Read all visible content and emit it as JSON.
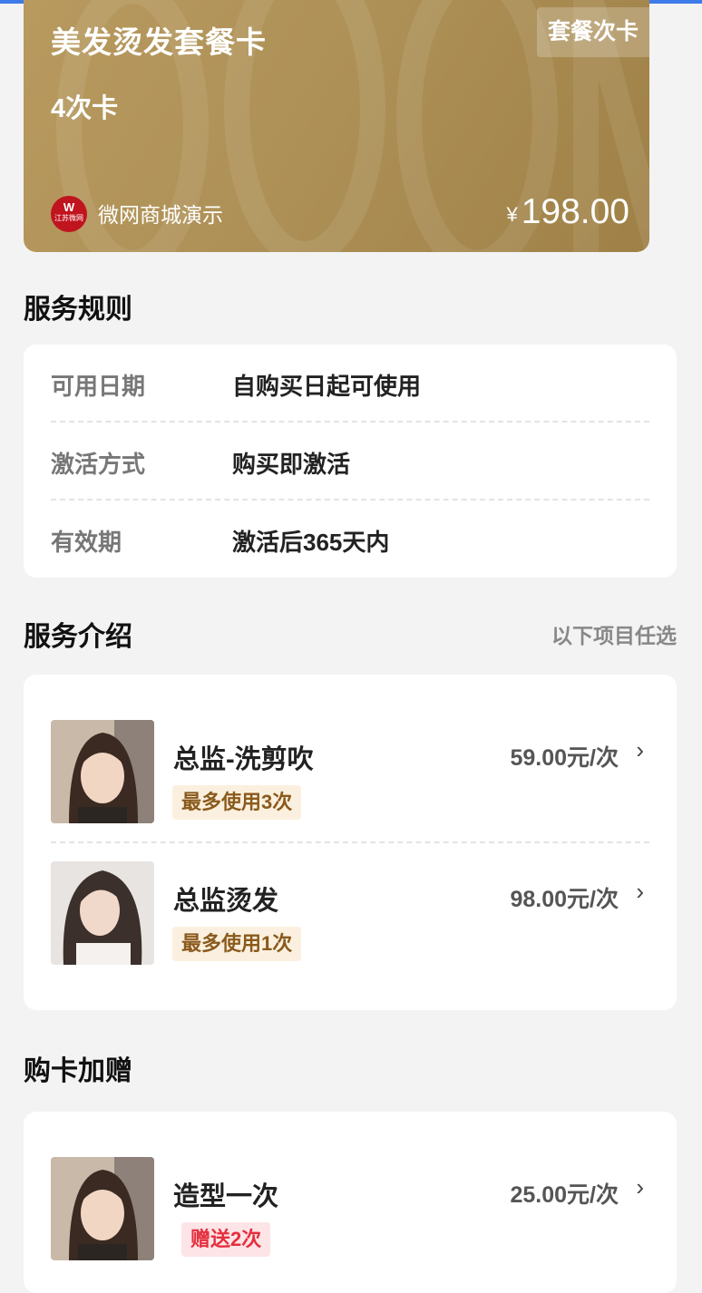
{
  "card": {
    "title": "美发烫发套餐卡",
    "count": "4次卡",
    "badge": "套餐次卡",
    "shop_logo_text": "W",
    "shop_logo_sub": "江苏微网",
    "shop_name": "微网商城演示",
    "currency": "¥",
    "price": "198.00"
  },
  "rules": {
    "title": "服务规则",
    "rows": [
      {
        "key": "可用日期",
        "value": "自购买日起可使用"
      },
      {
        "key": "激活方式",
        "value": "购买即激活"
      },
      {
        "key": "有效期",
        "value": "激活后365天内"
      }
    ]
  },
  "intro": {
    "title": "服务介绍",
    "hint": "以下项目任选",
    "items": [
      {
        "name": "总监-洗剪吹",
        "price": "59.00元/次",
        "tag": "最多使用3次"
      },
      {
        "name": "总监烫发",
        "price": "98.00元/次",
        "tag": "最多使用1次"
      }
    ]
  },
  "bonus": {
    "title": "购卡加赠",
    "items": [
      {
        "name": "造型一次",
        "price": "25.00元/次",
        "tag": "赠送2次"
      }
    ]
  },
  "icons": {
    "arrow": "chevron-right-icon"
  },
  "colors": {
    "card_gold": "#ae9157",
    "accent_blue": "#3d7be8",
    "tag_gold_bg": "#fbf0df",
    "tag_red_text": "#e52f3e"
  }
}
